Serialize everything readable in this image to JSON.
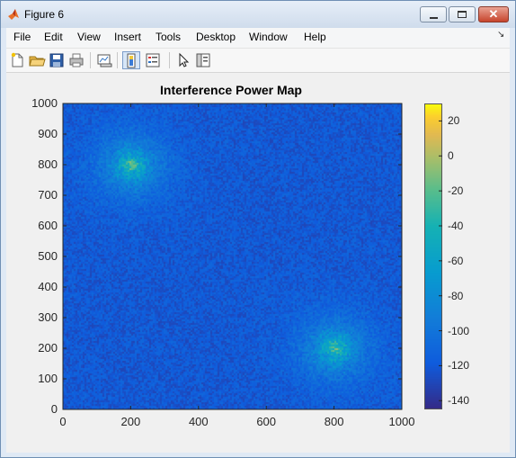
{
  "window": {
    "title": "Figure 6",
    "close_glyph": "✕",
    "icon": "matlab-icon"
  },
  "menu": {
    "items": [
      "File",
      "Edit",
      "View",
      "Insert",
      "Tools",
      "Desktop",
      "Window",
      "Help"
    ],
    "dock_arrow": "↘"
  },
  "toolbar": {
    "icons": [
      "new-figure-icon",
      "open-file-icon",
      "save-icon",
      "print-icon",
      "link-plot-icon",
      "colorbar-icon",
      "legend-icon",
      "pointer-icon",
      "property-editor-icon"
    ]
  },
  "chart_data": {
    "type": "heatmap",
    "title": "Interference Power Map",
    "xlabel": "",
    "ylabel": "",
    "xlim": [
      0,
      1000
    ],
    "ylim": [
      0,
      1000
    ],
    "x_ticks": [
      "0",
      "200",
      "400",
      "600",
      "800",
      "1000"
    ],
    "y_ticks": [
      "0",
      "100",
      "200",
      "300",
      "400",
      "500",
      "600",
      "700",
      "800",
      "900",
      "1000"
    ],
    "background_level": -120,
    "hotspots": [
      {
        "x": 200,
        "y": 800,
        "peak": 30
      },
      {
        "x": 800,
        "y": 200,
        "peak": 30
      }
    ],
    "colorbar": {
      "range": [
        -145,
        30
      ],
      "ticks": [
        "20",
        "0",
        "-20",
        "-40",
        "-60",
        "-80",
        "-100",
        "-120",
        "-140"
      ],
      "colormap": "parula"
    }
  }
}
